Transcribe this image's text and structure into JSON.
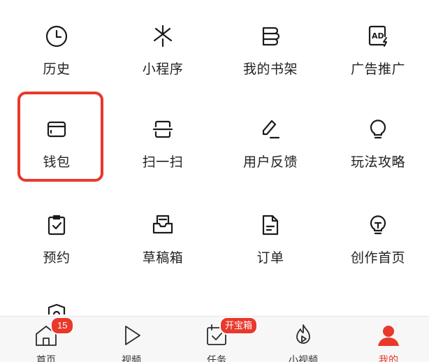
{
  "grid": {
    "items": [
      {
        "label": "历史",
        "icon": "clock-icon"
      },
      {
        "label": "小程序",
        "icon": "mini-program-icon"
      },
      {
        "label": "我的书架",
        "icon": "bookshelf-icon"
      },
      {
        "label": "广告推广",
        "icon": "ad-icon"
      },
      {
        "label": "钱包",
        "icon": "wallet-icon"
      },
      {
        "label": "扫一扫",
        "icon": "scan-icon"
      },
      {
        "label": "用户反馈",
        "icon": "feedback-pen-icon"
      },
      {
        "label": "玩法攻略",
        "icon": "lightbulb-icon"
      },
      {
        "label": "预约",
        "icon": "clipboard-check-icon"
      },
      {
        "label": "草稿箱",
        "icon": "drafts-icon"
      },
      {
        "label": "订单",
        "icon": "order-document-icon"
      },
      {
        "label": "创作首页",
        "icon": "creator-bulb-icon"
      }
    ],
    "partial_item": {
      "icon": "shield-icon"
    },
    "highlight_color": "#e8392b"
  },
  "tabbar": {
    "tabs": [
      {
        "label": "首页",
        "icon": "home-icon",
        "badge": "15"
      },
      {
        "label": "视频",
        "icon": "play-icon"
      },
      {
        "label": "任务",
        "icon": "task-calendar-icon",
        "badge": "开宝箱"
      },
      {
        "label": "小视频",
        "icon": "flame-play-icon"
      },
      {
        "label": "我的",
        "icon": "user-icon",
        "active": true
      }
    ],
    "accent": "#e8392b"
  }
}
